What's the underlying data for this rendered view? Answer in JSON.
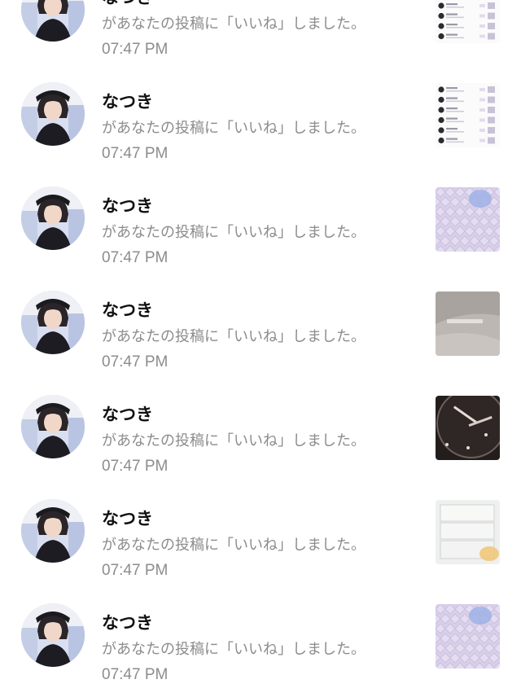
{
  "notifications": [
    {
      "user": "なつき",
      "message": "があなたの投稿に「いいね」しました。",
      "time": "07:47 PM",
      "thumbnail": "screenshot-list"
    },
    {
      "user": "なつき",
      "message": "があなたの投稿に「いいね」しました。",
      "time": "07:47 PM",
      "thumbnail": "screenshot-list"
    },
    {
      "user": "なつき",
      "message": "があなたの投稿に「いいね」しました。",
      "time": "07:47 PM",
      "thumbnail": "lavender-quilted"
    },
    {
      "user": "なつき",
      "message": "があなたの投稿に「いいね」しました。",
      "time": "07:47 PM",
      "thumbnail": "grey-fabric"
    },
    {
      "user": "なつき",
      "message": "があなたの投稿に「いいね」しました。",
      "time": "07:47 PM",
      "thumbnail": "clock-face"
    },
    {
      "user": "なつき",
      "message": "があなたの投稿に「いいね」しました。",
      "time": "07:47 PM",
      "thumbnail": "clear-case"
    },
    {
      "user": "なつき",
      "message": "があなたの投稿に「いいね」しました。",
      "time": "07:47 PM",
      "thumbnail": "lavender-quilted"
    }
  ],
  "colors": {
    "name": "#111111",
    "secondary_text": "#8c8c8c",
    "background": "#ffffff"
  }
}
